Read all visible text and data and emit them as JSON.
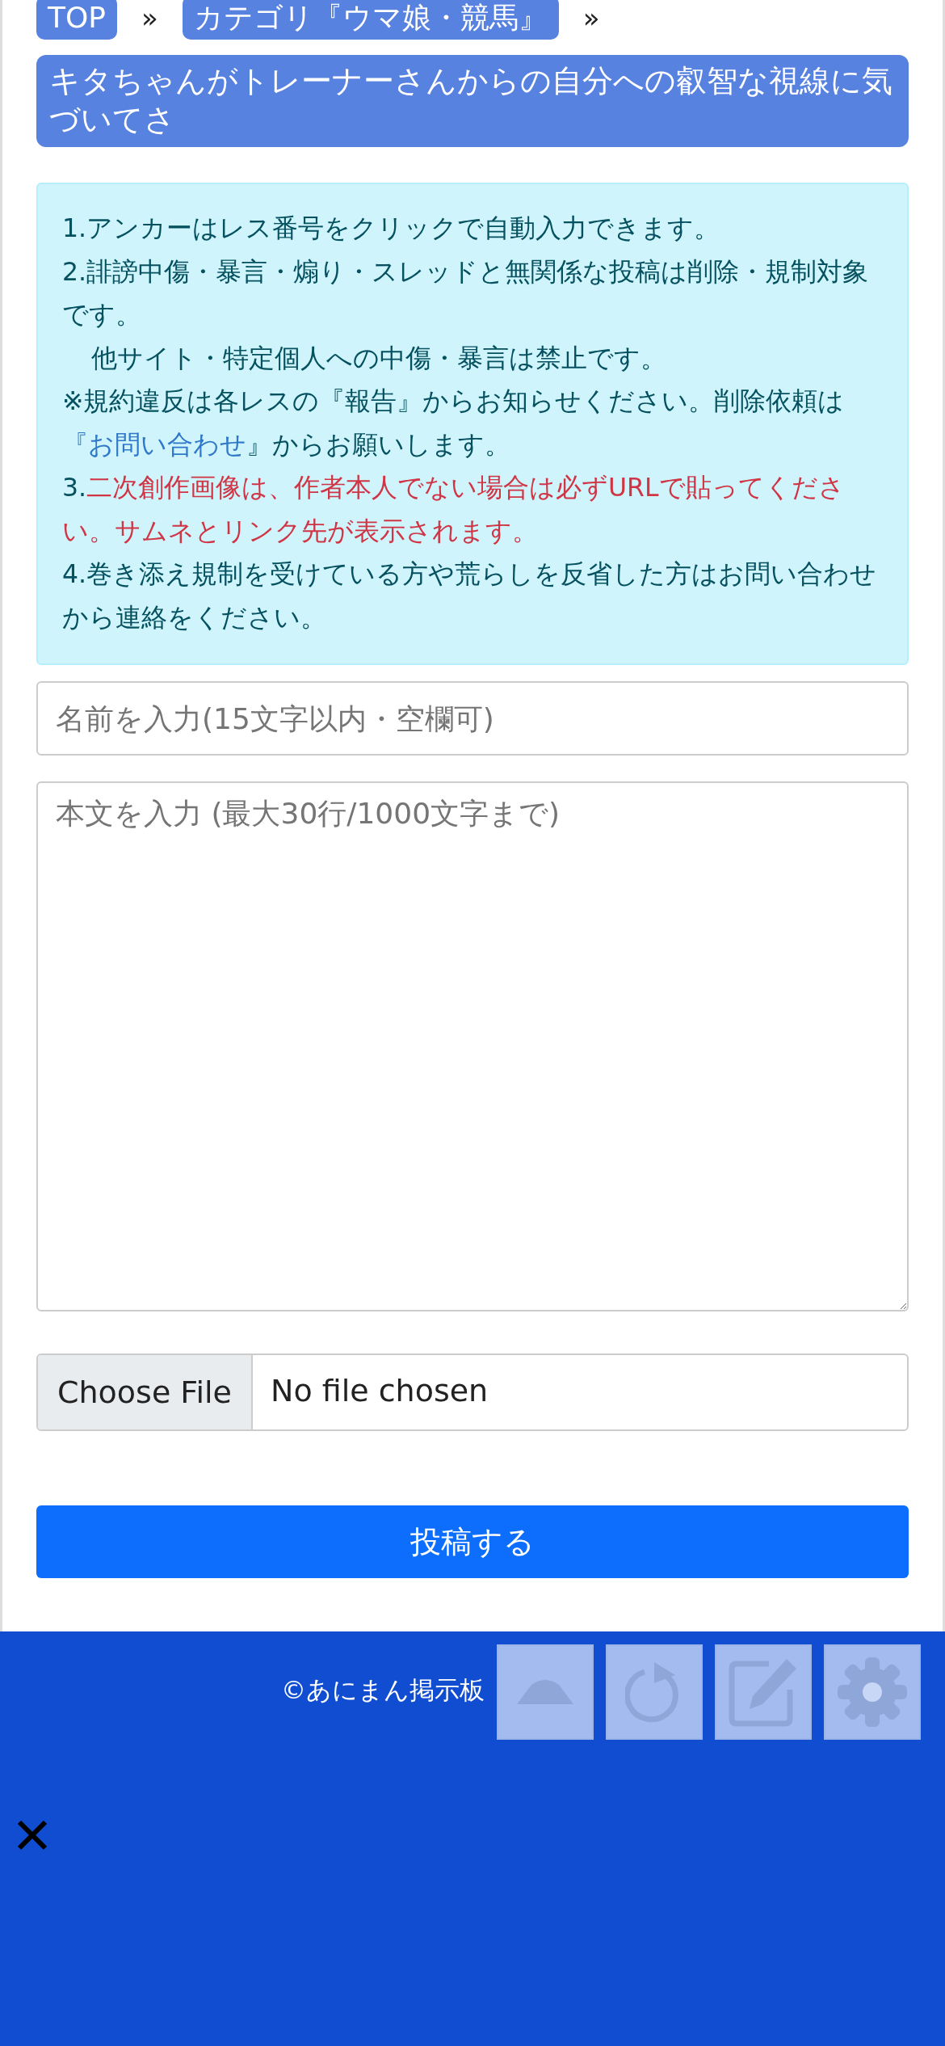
{
  "breadcrumbs": [
    {
      "label": "TOP",
      "separator": "»"
    },
    {
      "label": "カテゴリ『ウマ娘・競馬』",
      "separator": "»"
    }
  ],
  "thread_title": "キタちゃんがトレーナーさんからの自分への叡智な視線に気づいてさ",
  "notice": [
    {
      "kind": "normal",
      "parts": [
        {
          "kind": "text",
          "text": "1.アンカーはレス番号をクリックで自動入力できます。"
        }
      ]
    },
    {
      "kind": "normal",
      "parts": [
        {
          "kind": "text",
          "text": "2.誹謗中傷・暴言・煽り・スレッドと無関係な投稿は削除・規制対象です。"
        }
      ]
    },
    {
      "kind": "indent",
      "parts": [
        {
          "kind": "text",
          "text": "他サイト・特定個人への中傷・暴言は禁止です。"
        }
      ]
    },
    {
      "kind": "normal",
      "parts": [
        {
          "kind": "text",
          "text": "※規約違反は各レスの『報告』からお知らせください。削除依頼は"
        },
        {
          "kind": "link",
          "text": "『お問い合わせ"
        },
        {
          "kind": "text",
          "text": "』からお願いします。"
        }
      ]
    },
    {
      "kind": "normal",
      "parts": [
        {
          "kind": "text",
          "text": "3."
        },
        {
          "kind": "alert",
          "text": "二次創作画像は、作者本人でない場合は必ずURLで貼ってください。サムネとリンク先が表示されます。"
        }
      ]
    },
    {
      "kind": "normal",
      "parts": [
        {
          "kind": "text",
          "text": "4.巻き添え規制を受けている方や荒らしを反省した方はお問い合わせから連絡をください。"
        }
      ]
    }
  ],
  "form": {
    "name_placeholder": "名前を入力(15文字以内・空欄可)",
    "body_placeholder": "本文を入力 (最大30行/1000文字まで)",
    "file_button": "Choose File",
    "file_status": "No file chosen",
    "submit": "投稿する"
  },
  "footer": {
    "copyright": "©あにまん掲示板"
  }
}
